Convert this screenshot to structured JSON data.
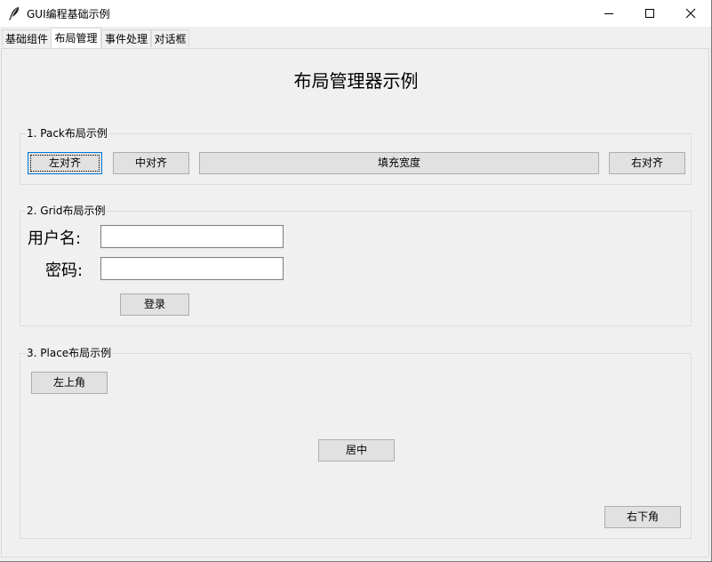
{
  "window": {
    "title": "GUI编程基础示例",
    "icon": "feather-icon",
    "controls": [
      "minimize-icon",
      "maximize-icon",
      "close-icon"
    ]
  },
  "tabs": [
    {
      "label": "基础组件",
      "active": false
    },
    {
      "label": "布局管理",
      "active": true
    },
    {
      "label": "事件处理",
      "active": false
    },
    {
      "label": "对话框",
      "active": false
    }
  ],
  "page": {
    "heading": "布局管理器示例",
    "pack": {
      "title": "1. Pack布局示例",
      "left_button": "左对齐",
      "center_button": "中对齐",
      "fill_button": "填充宽度",
      "right_button": "右对齐"
    },
    "grid": {
      "title": "2. Grid布局示例",
      "username_label": "用户名:",
      "username_value": "",
      "password_label": "密码:",
      "password_value": "",
      "login_button": "登录"
    },
    "place": {
      "title": "3. Place布局示例",
      "top_left_button": "左上角",
      "center_button": "居中",
      "bottom_right_button": "右下角"
    }
  },
  "colors": {
    "window_bg": "#f0f0f0",
    "button_bg": "#e1e1e1",
    "button_border": "#adadad",
    "focus_border": "#0078d7"
  }
}
